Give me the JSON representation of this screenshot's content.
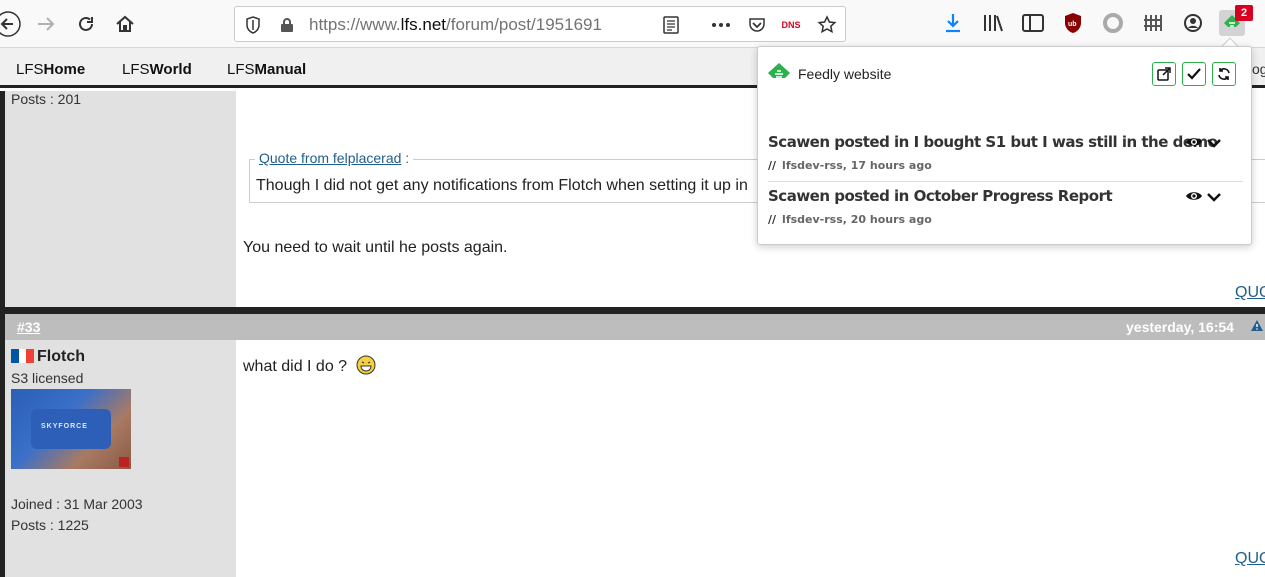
{
  "browser": {
    "url_prefix": "https://www.",
    "url_domain": "lfs.net",
    "url_path": "/forum/post/1951691",
    "dns_label": "DNS",
    "badge_count": "2"
  },
  "site_nav": {
    "items": [
      {
        "prefix": "LFS",
        "bold": "Home"
      },
      {
        "prefix": "LFS",
        "bold": "World"
      },
      {
        "prefix": "LFS",
        "bold": "Manual"
      }
    ],
    "right_fragment": "og"
  },
  "post1": {
    "posts_count": "Posts : 201",
    "quote_label": "Quote from felplacerad",
    "quote_colon": ":",
    "quote_text": "Though I did not get any notifications from Flotch when setting it up in",
    "body": "You need to wait until he posts again.",
    "quote_link": "QUO"
  },
  "post2": {
    "number": "#33",
    "time": "yesterday, 16:54",
    "username": "Flotch",
    "rank": "S3 licensed",
    "avatar_text": "SKYFORCE",
    "joined": "Joined : 31 Mar 2003",
    "posts_count": "Posts : 1225",
    "body": "what did I do ?",
    "quote_link": "QUO"
  },
  "feedly": {
    "title": "Feedly website",
    "items": [
      {
        "title": "Scawen posted in I bought S1 but I was still in the demo",
        "source": "lfsdev-rss",
        "age": "17 hours ago"
      },
      {
        "title": "Scawen posted in October Progress Report",
        "source": "lfsdev-rss",
        "age": "20 hours ago"
      }
    ]
  },
  "colors": {
    "feedly_green": "#2bb24c",
    "link_blue": "#1f5f8b",
    "header_gray": "#bdbdbd",
    "sidebar_gray": "#e1e1e1"
  }
}
